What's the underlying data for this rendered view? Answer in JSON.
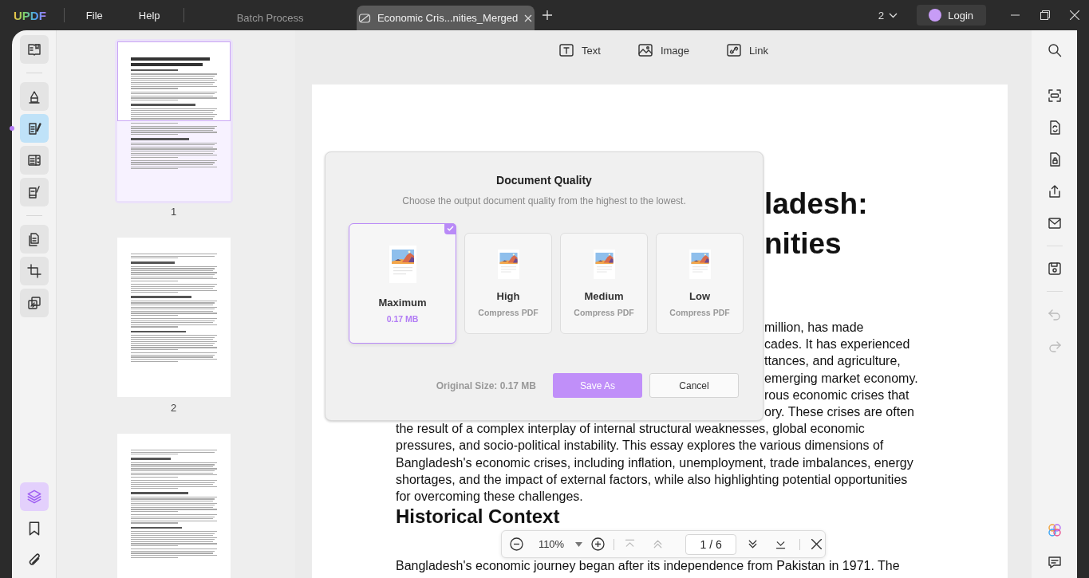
{
  "title_bar": {
    "logo": "UPDF",
    "menu": [
      "File",
      "Help"
    ],
    "tabs": [
      {
        "label": "Batch Process",
        "selected": false
      },
      {
        "label": "Economic Cris...nities_Merged",
        "selected": true
      }
    ],
    "window_count": "2",
    "login": "Login"
  },
  "left_rail": {
    "groups": [
      {
        "tools": [
          {
            "kind": "reader",
            "selected": false
          }
        ]
      },
      {
        "tools": [
          {
            "kind": "comment",
            "selected": false
          },
          {
            "kind": "edit",
            "selected": true
          },
          {
            "kind": "organize",
            "selected": false
          },
          {
            "kind": "sign",
            "selected": false
          }
        ]
      },
      {
        "tools": [
          {
            "kind": "pages",
            "selected": false
          },
          {
            "kind": "crop",
            "selected": false
          },
          {
            "kind": "compare",
            "selected": false
          }
        ]
      }
    ],
    "bottom": [
      {
        "kind": "layers",
        "selected": true
      },
      {
        "kind": "bookmark",
        "selected": false
      },
      {
        "kind": "attachment",
        "selected": false
      }
    ]
  },
  "thumbnails": [
    {
      "label": "1",
      "selected": true
    },
    {
      "label": "2",
      "selected": false
    },
    {
      "selected": false
    }
  ],
  "edit_toolbar": [
    {
      "kind": "text",
      "label": "Text"
    },
    {
      "kind": "image",
      "label": "Image"
    },
    {
      "kind": "link",
      "label": "Link"
    }
  ],
  "document": {
    "title_fragments": [
      "ladesh:",
      "nities"
    ],
    "fragments": [
      "million, has made",
      "cades. It has experienced",
      "ttances, and agriculture,",
      "emerging market economy.",
      "rous economic crises that",
      "ory. These crises are often"
    ],
    "lines": [
      "the result of a complex interplay of internal structural weaknesses, global economic",
      "pressures, and socio-political instability. This essay explores the various dimensions of",
      "Bangladesh's economic crises, including inflation, unemployment, trade imbalances, energy",
      "shortages, and the impact of external factors, while also highlighting potential opportunities",
      "for overcoming these challenges."
    ],
    "heading": "Historical Context",
    "next_lines": [
      "Bangladesh's economic journey began after its independence from Pakistan in 1971. The"
    ]
  },
  "dialog": {
    "title": "Document Quality",
    "subtitle": "Choose the output document quality from the highest to the lowest.",
    "options": [
      {
        "label": "Maximum",
        "detail": "0.17 MB",
        "selected": true
      },
      {
        "label": "High",
        "detail": "Compress PDF",
        "selected": false
      },
      {
        "label": "Medium",
        "detail": "Compress PDF",
        "selected": false
      },
      {
        "label": "Low",
        "detail": "Compress PDF",
        "selected": false
      }
    ],
    "original_size": "Original Size: 0.17 MB",
    "buttons": [
      {
        "kind": "primary",
        "label": "Save As"
      },
      {
        "kind": "secondary",
        "label": "Cancel"
      }
    ]
  },
  "page_nav": {
    "zoom": "110%",
    "page": "1 / 6",
    "buttons": [
      {
        "kind": "first",
        "disabled": true
      },
      {
        "kind": "previous",
        "disabled": true
      },
      {
        "kind": "next",
        "disabled": false
      },
      {
        "kind": "last",
        "disabled": false
      }
    ]
  },
  "right_rail": {
    "groups": [
      {
        "tools": [
          {
            "kind": "search",
            "disabled": false
          }
        ]
      },
      {
        "tools": [
          {
            "kind": "ocr",
            "disabled": false
          },
          {
            "kind": "convert",
            "disabled": false
          },
          {
            "kind": "protect",
            "disabled": false
          },
          {
            "kind": "share",
            "disabled": false
          },
          {
            "kind": "email",
            "disabled": false
          }
        ]
      },
      {
        "tools": [
          {
            "kind": "save",
            "disabled": false
          }
        ]
      },
      {
        "tools": [
          {
            "kind": "undo",
            "disabled": true
          },
          {
            "kind": "redo",
            "disabled": true
          }
        ]
      }
    ],
    "bottom": [
      {
        "kind": "ai"
      },
      {
        "kind": "chat"
      }
    ]
  }
}
